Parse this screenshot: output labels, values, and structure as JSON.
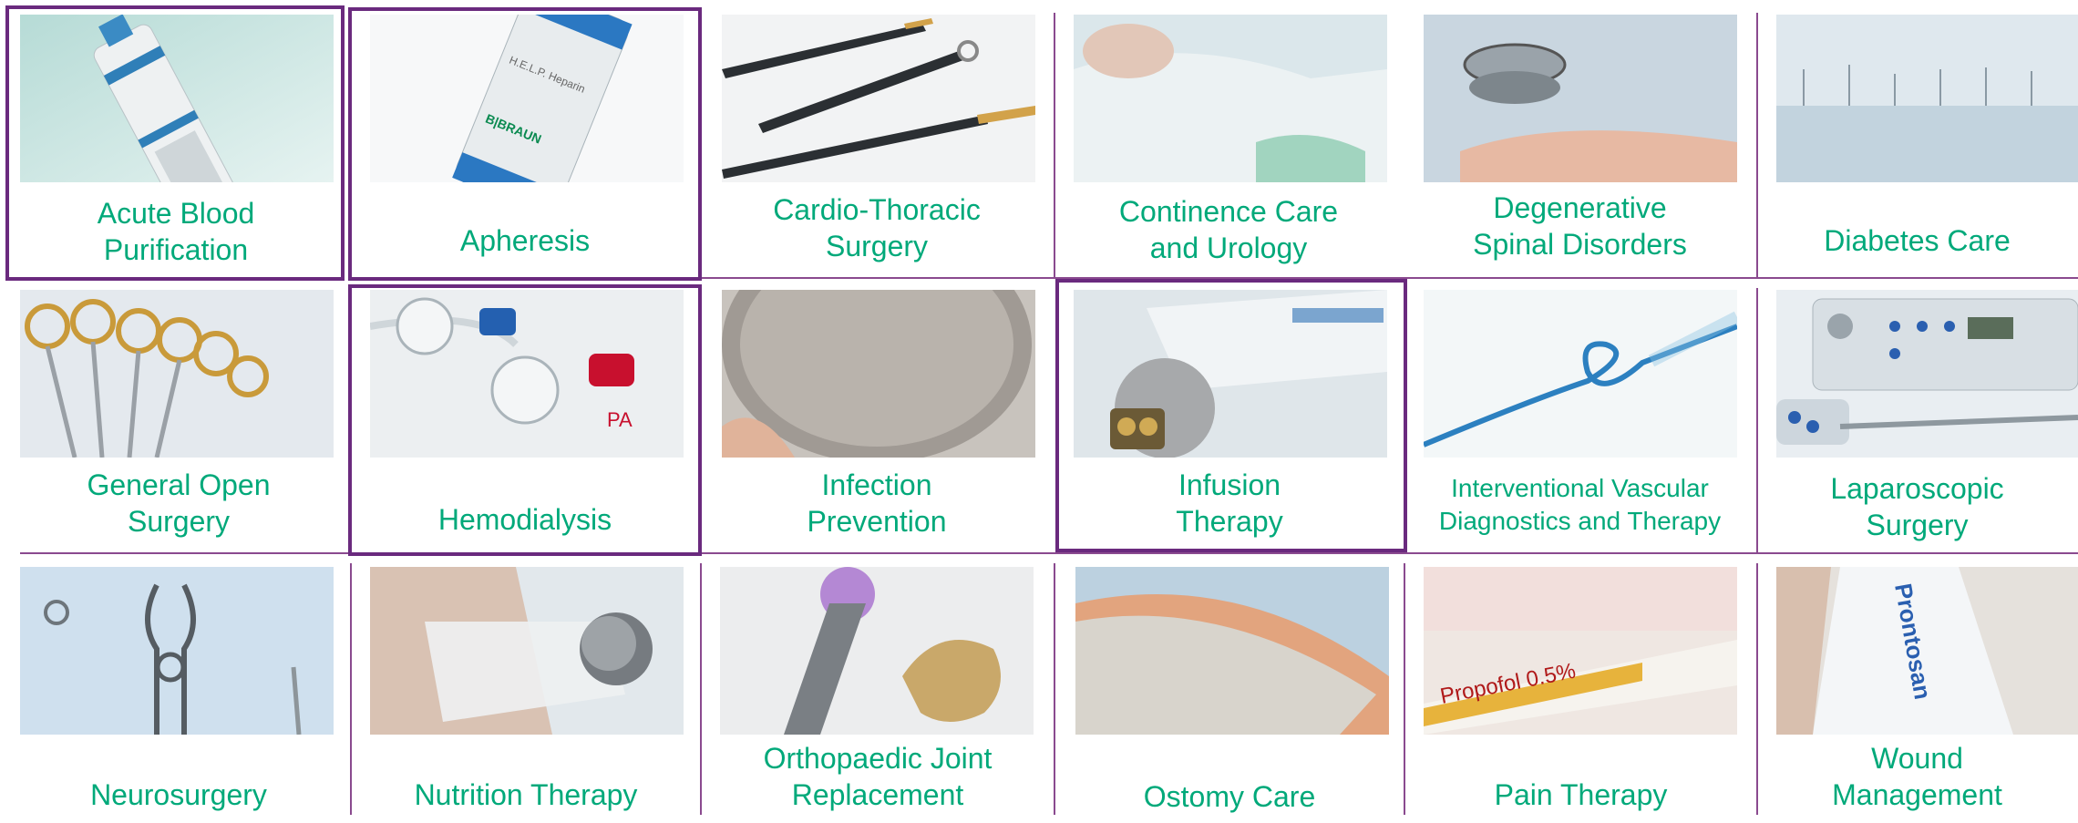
{
  "tiles": [
    {
      "label_lines": [
        "Acute Blood",
        "Purification"
      ],
      "icon": "blood-filter-image",
      "highlighted": true
    },
    {
      "label_lines": [
        "Apheresis"
      ],
      "icon": "heparin-filter-image",
      "highlighted": true
    },
    {
      "label_lines": [
        "Cardio-Thoracic",
        "Surgery"
      ],
      "icon": "surgical-instruments-image",
      "highlighted": false
    },
    {
      "label_lines": [
        "Continence Care",
        "and Urology"
      ],
      "icon": "urology-bag-image",
      "highlighted": false
    },
    {
      "label_lines": [
        "Degenerative",
        "Spinal Disorders"
      ],
      "icon": "spinal-implant-image",
      "highlighted": false
    },
    {
      "label_lines": [
        "Diabetes Care"
      ],
      "icon": "needles-image",
      "highlighted": false
    },
    {
      "label_lines": [
        "General Open",
        "Surgery"
      ],
      "icon": "scissors-image",
      "highlighted": false
    },
    {
      "label_lines": [
        "Hemodialysis"
      ],
      "icon": "dialysis-filters-image",
      "highlighted": true
    },
    {
      "label_lines": [
        "Infection",
        "Prevention"
      ],
      "icon": "dish-image",
      "highlighted": false
    },
    {
      "label_lines": [
        "Infusion",
        "Therapy"
      ],
      "icon": "infusion-bag-image",
      "highlighted": true
    },
    {
      "label_lines": [
        "Interventional Vascular",
        "Diagnostics and Therapy"
      ],
      "icon": "catheter-image",
      "highlighted": false
    },
    {
      "label_lines": [
        "Laparoscopic",
        "Surgery"
      ],
      "icon": "laparoscopy-device-image",
      "highlighted": false
    },
    {
      "label_lines": [
        "Neurosurgery"
      ],
      "icon": "neuro-clips-image",
      "highlighted": false
    },
    {
      "label_lines": [
        "Nutrition Therapy"
      ],
      "icon": "nutrition-bag-image",
      "highlighted": false
    },
    {
      "label_lines": [
        "Orthopaedic Joint",
        "Replacement"
      ],
      "icon": "joint-implant-image",
      "highlighted": false
    },
    {
      "label_lines": [
        "Ostomy Care"
      ],
      "icon": "ostomy-bag-image",
      "highlighted": false
    },
    {
      "label_lines": [
        "Pain Therapy"
      ],
      "icon": "propofol-syringe-image",
      "highlighted": false
    },
    {
      "label_lines": [
        "Wound",
        "Management"
      ],
      "icon": "wound-solution-image",
      "highlighted": false
    }
  ],
  "image_text": {
    "apheresis_bottle": "H.E.L.P. Heparin",
    "apheresis_brand": "B|BRAUN",
    "hemodialysis_tag": "PA",
    "pain_label": "Propofol 0.5%",
    "wound_label": "Prontosan"
  },
  "colors": {
    "label_green": "#00a97a",
    "grid_purple": "#8a4a8f",
    "highlight_purple": "#6a2a7e"
  }
}
